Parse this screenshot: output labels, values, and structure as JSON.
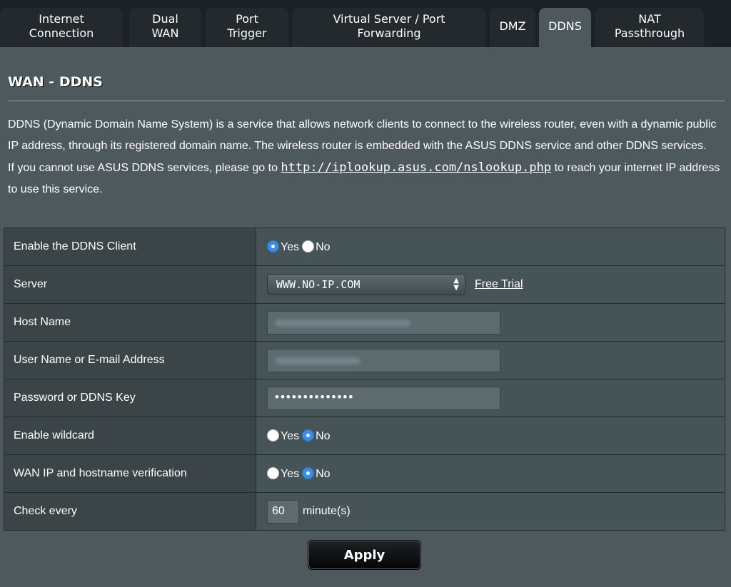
{
  "tabs": [
    {
      "label": "Internet\nConnection"
    },
    {
      "label": "Dual\nWAN"
    },
    {
      "label": "Port\nTrigger"
    },
    {
      "label": "Virtual Server / Port\nForwarding"
    },
    {
      "label": "DMZ"
    },
    {
      "label": "DDNS",
      "active": true
    },
    {
      "label": "NAT\nPassthrough"
    }
  ],
  "page_title": "WAN - DDNS",
  "description": {
    "text1": "DDNS (Dynamic Domain Name System) is a service that allows network clients to connect to the wireless router, even with a dynamic public IP address, through its registered domain name. The wireless router is embedded with the ASUS DDNS service and other DDNS services.",
    "text2_before": "If you cannot use ASUS DDNS services, please go to ",
    "link": "http://iplookup.asus.com/nslookup.php",
    "text2_after": " to reach your internet IP address to use this service."
  },
  "form": {
    "enable_ddns": {
      "label": "Enable the DDNS Client",
      "yes": "Yes",
      "no": "No",
      "selected": "Yes"
    },
    "server": {
      "label": "Server",
      "value": "WWW.NO-IP.COM",
      "free_trial": "Free Trial"
    },
    "host_name": {
      "label": "Host Name"
    },
    "username": {
      "label": "User Name or E-mail Address"
    },
    "password": {
      "label": "Password or DDNS Key",
      "masked_value": "••••••••••••••"
    },
    "wildcard": {
      "label": "Enable wildcard",
      "yes": "Yes",
      "no": "No",
      "selected": "No"
    },
    "verification": {
      "label": "WAN IP and hostname verification",
      "yes": "Yes",
      "no": "No",
      "selected": "No"
    },
    "check_every": {
      "label": "Check every",
      "value": "60",
      "unit": "minute(s)"
    }
  },
  "apply_label": "Apply",
  "colors": {
    "background": "#4d595d",
    "tab_bar": "#1b2225",
    "radio_selected": "#3b8de8"
  }
}
